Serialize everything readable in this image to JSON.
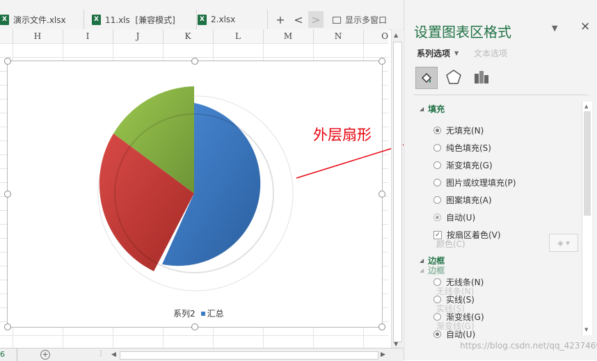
{
  "file_tabs": [
    {
      "name": "演示文件.xlsx"
    },
    {
      "name": "11.xls  [兼容模式]"
    },
    {
      "name": "2.xlsx"
    }
  ],
  "tab_toolbar": {
    "add": "+",
    "prev": "<",
    "next": ">",
    "multi_window": "显示多窗口"
  },
  "columns": [
    "H",
    "I",
    "J",
    "K",
    "L",
    "M",
    "N",
    "O"
  ],
  "chart": {
    "legend": [
      {
        "name": "系列2"
      },
      {
        "name": "汇总"
      }
    ],
    "annotation": "外层扇形",
    "colors": {
      "blue": "#3b7cc6",
      "red": "#cc3d3a",
      "green": "#8db84a",
      "annotation": "#e8000b"
    }
  },
  "sheet_tab": "6",
  "panel": {
    "title": "设置图表区格式",
    "tab_series": "系列选项",
    "tab_text": "文本选项",
    "fill_section": "填充",
    "fill_options": [
      "无填充(N)",
      "纯色填充(S)",
      "渐变填充(G)",
      "图片或纹理填充(P)",
      "图案填充(A)",
      "自动(U)"
    ],
    "vary_by_point": "按扇区着色(V)",
    "color_label": "颜色(C)",
    "border_section": "边框",
    "border_section_ghost": "边框",
    "border_options": [
      "无线条(N)",
      "实线(S)",
      "渐变线(G)",
      "自动(U)"
    ],
    "border_ghosts": [
      "无线条(N)",
      "实线(S)",
      "渐变线(G)"
    ],
    "watermark": "https://blog.csdn.net/qq_42374697"
  }
}
